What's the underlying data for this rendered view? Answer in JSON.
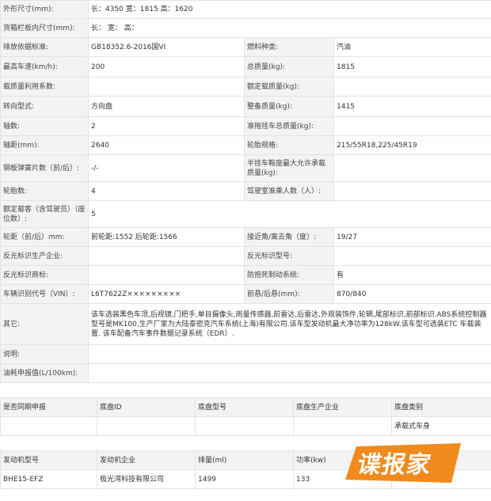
{
  "spec_rows": [
    {
      "l1": "外形尺寸(mm):",
      "v1": "长：4350 宽：1815 高：1620",
      "span": true
    },
    {
      "l1": "货箱栏板内尺寸(mm):",
      "v1": "长：  宽：  高：",
      "span": true
    },
    {
      "l1": "排放依据标准:",
      "v1": "GB18352.6-2016国VI",
      "l2": "燃料种类:",
      "v2": "汽油"
    },
    {
      "l1": "最高车速(km/h):",
      "v1": "200",
      "l2": "总质量(kg):",
      "v2": "1815"
    },
    {
      "l1": "载质量利用系数:",
      "v1": "",
      "l2": "额定载质量(kg):",
      "v2": ""
    },
    {
      "l1": "转向型式:",
      "v1": "方向盘",
      "l2": "整备质量(kg):",
      "v2": "1415"
    },
    {
      "l1": "轴数:",
      "v1": "2",
      "l2": "准拖挂车总质量(kg):",
      "v2": ""
    },
    {
      "l1": "轴距(mm):",
      "v1": "2640",
      "l2": "轮胎规格:",
      "v2": "215/55R18,225/45R19"
    },
    {
      "l1": "钢板弹簧片数（前/后）:",
      "v1": "-/-",
      "l2": "半挂车鞍座最大允许承载质量(kg):",
      "v2": ""
    },
    {
      "l1": "轮胎数:",
      "v1": "4",
      "l2": "驾驶室准乘人数（人）:",
      "v2": ""
    },
    {
      "l1": "额定载客（含驾驶员）（座位数）:",
      "v1": "5",
      "span": true
    },
    {
      "l1": "轮距（前/后）mm:",
      "v1": "前轮距:1552 后轮距:1566",
      "l2": "接近角/离去角（度）:",
      "v2": "19/27"
    },
    {
      "l1": "反光标识生产企业:",
      "v1": "",
      "l2": "反光标识型号:",
      "v2": ""
    },
    {
      "l1": "反光标识商标:",
      "v1": "",
      "l2": "防抱死制动系统:",
      "v2": "有"
    },
    {
      "l1": "车辆识别代号（VIN）:",
      "v1": "L6T7622Z×××××××××",
      "l2": "前悬/后悬(mm):",
      "v2": "870/840"
    },
    {
      "l1": "其它:",
      "v1": "该车选装黑色车顶,后视镜,门把手,单目摄像头,雨量传感器,前雷达,后雷达,外观装饰件,轮辋,尾部标识,前部标识.ABS系统控制器型号是MK100,生产厂家为大陆泰密克汽车系统(上海)有限公司.该车型发动机最大净功率为128kW.该车型可选装ETC 车载装置. 该车配备汽车事件数据记录系统（EDR）.",
      "span": true
    },
    {
      "l1": "说明:",
      "v1": "",
      "span": true
    },
    {
      "l1": "油耗申报值(L/100km):",
      "v1": "",
      "span": true
    }
  ],
  "chassis": {
    "headers": [
      "是否同期申报",
      "底盘ID",
      "底盘型号",
      "底盘生产企业",
      "底盘类别"
    ],
    "row": [
      "",
      "",
      "",
      "",
      "承载式车身"
    ]
  },
  "engine": {
    "headers": [
      "发动机型号",
      "发动机企业",
      "排量(ml)",
      "功率(kw)",
      ""
    ],
    "row": [
      "BHE15-EFZ",
      "极光湾科技有限公司",
      "1499",
      "133",
      ""
    ]
  },
  "logo": {
    "text": "谍报家",
    "color": "#f08a1c"
  }
}
